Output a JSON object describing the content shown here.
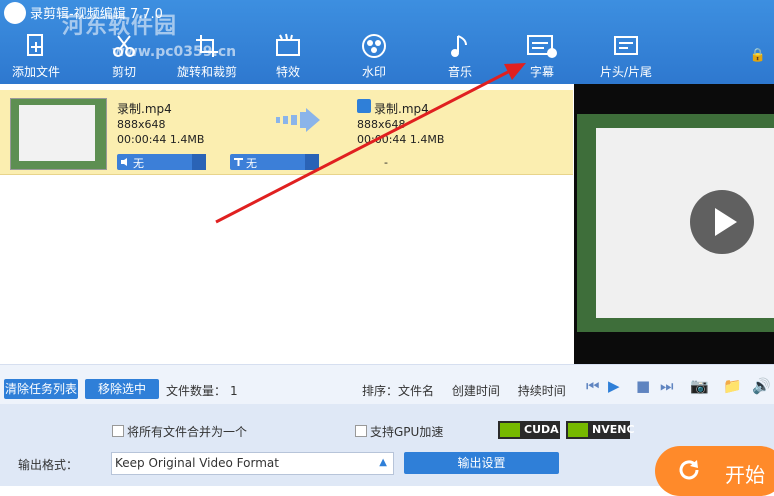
{
  "window": {
    "title": "录剪辑-视频编辑 7.7.0"
  },
  "watermark": {
    "text": "河东软件园",
    "url": "www.pc0359.cn"
  },
  "toolbar": {
    "items": [
      {
        "label": "添加文件",
        "icon": "add-file-icon"
      },
      {
        "label": "剪切",
        "icon": "scissors-icon"
      },
      {
        "label": "旋转和裁剪",
        "icon": "crop-rotate-icon"
      },
      {
        "label": "特效",
        "icon": "effects-icon"
      },
      {
        "label": "水印",
        "icon": "watermark-icon"
      },
      {
        "label": "音乐",
        "icon": "music-icon"
      },
      {
        "label": "字幕",
        "icon": "subtitle-icon"
      },
      {
        "label": "片头/片尾",
        "icon": "intro-outro-icon"
      }
    ]
  },
  "file": {
    "source": {
      "name": "录制.mp4",
      "resolution": "888x648",
      "duration_size": "00:00:44 1.4MB"
    },
    "output": {
      "name": "录制.mp4",
      "resolution": "888x648",
      "duration_size": "00:00:44 1.4MB"
    },
    "audio_track": "无",
    "subtitle_track": "无",
    "extra": "-"
  },
  "task_bar": {
    "clear_label": "清除任务列表",
    "remove_label": "移除选中",
    "count_label": "文件数量：",
    "count_value": "1",
    "sort_label": "排序：",
    "sort_name": "文件名",
    "sort_created": "创建时间",
    "sort_duration": "持续时间"
  },
  "settings": {
    "merge_label": "将所有文件合并为一个",
    "gpu_label": "支持GPU加速",
    "cuda_label": "CUDA",
    "nvenc_label": "NVENC",
    "output_format_label": "输出格式：",
    "output_format_value": "Keep Original Video Format",
    "output_settings_label": "输出设置",
    "start_label": "开始"
  },
  "colors": {
    "toolbar": "#2e78cf",
    "accent": "#2f7fd8",
    "selected_row": "#fbeeb0",
    "start": "#ff8a2a",
    "annotation_arrow": "#e02020"
  }
}
